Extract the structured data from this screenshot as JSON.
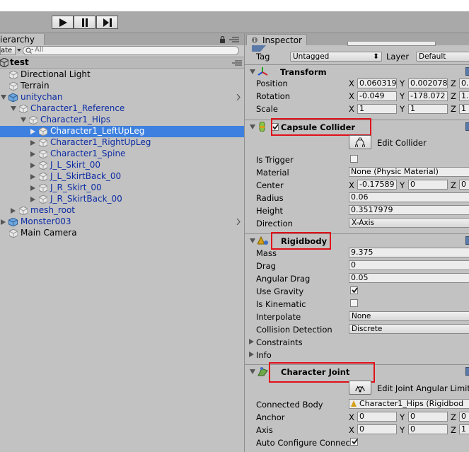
{
  "toolbar": {
    "play_icon": "play-icon",
    "pause_icon": "pause-icon",
    "step_icon": "step-icon"
  },
  "hierarchy": {
    "tab_label": "ierarchy",
    "create_label": "ate",
    "search_placeholder": "All",
    "scene_name": "test",
    "items": [
      {
        "label": "Directional Light",
        "blue": false
      },
      {
        "label": "Terrain",
        "blue": false
      },
      {
        "label": "unitychan",
        "blue": true
      },
      {
        "label": "Character1_Reference",
        "blue": true
      },
      {
        "label": "Character1_Hips",
        "blue": true
      },
      {
        "label": "Character1_LeftUpLeg",
        "blue": true,
        "selected": true
      },
      {
        "label": "Character1_RightUpLeg",
        "blue": true
      },
      {
        "label": "Character1_Spine",
        "blue": true
      },
      {
        "label": "J_L_Skirt_00",
        "blue": true
      },
      {
        "label": "J_L_SkirtBack_00",
        "blue": true
      },
      {
        "label": "J_R_Skirt_00",
        "blue": true
      },
      {
        "label": "J_R_SkirtBack_00",
        "blue": true
      },
      {
        "label": "mesh_root",
        "blue": true
      },
      {
        "label": "Monster003",
        "blue": true
      },
      {
        "label": "Main Camera",
        "blue": false
      }
    ]
  },
  "inspector": {
    "tab_label": "Inspector",
    "tag_label": "Tag",
    "tag_value": "Untagged",
    "layer_label": "Layer",
    "layer_value": "Default",
    "transform": {
      "title": "Transform",
      "position_label": "Position",
      "position": [
        "0.060319",
        "0.002078",
        "0."
      ],
      "rotation_label": "Rotation",
      "rotation": [
        "-0.049",
        "-178.072",
        "1."
      ],
      "scale_label": "Scale",
      "scale": [
        "1",
        "1",
        "1"
      ],
      "x": "X",
      "y": "Y",
      "z": "Z"
    },
    "capsule": {
      "title": "Capsule Collider",
      "edit_label": "Edit Collider",
      "is_trigger_label": "Is Trigger",
      "material_label": "Material",
      "material_value": "None (Physic Material)",
      "center_label": "Center",
      "center": [
        "-0.17589",
        "0",
        "0"
      ],
      "radius_label": "Radius",
      "radius_value": "0.06",
      "height_label": "Height",
      "height_value": "0.3517979",
      "direction_label": "Direction",
      "direction_value": "X-Axis"
    },
    "rigidbody": {
      "title": "Rigidbody",
      "mass_label": "Mass",
      "mass_value": "9.375",
      "drag_label": "Drag",
      "drag_value": "0",
      "angular_drag_label": "Angular Drag",
      "angular_drag_value": "0.05",
      "use_gravity_label": "Use Gravity",
      "is_kinematic_label": "Is Kinematic",
      "interpolate_label": "Interpolate",
      "interpolate_value": "None",
      "collision_label": "Collision Detection",
      "collision_value": "Discrete",
      "constraints_label": "Constraints",
      "info_label": "Info"
    },
    "joint": {
      "title": "Character Joint",
      "edit_label": "Edit Joint Angular Limit",
      "connected_label": "Connected Body",
      "connected_value": "Character1_Hips (Rigidbod",
      "anchor_label": "Anchor",
      "anchor": [
        "0",
        "0",
        "0"
      ],
      "axis_label": "Axis",
      "axis": [
        "0",
        "0",
        "1"
      ],
      "auto_label": "Auto Configure Connec"
    },
    "colors": {
      "highlight": "#e0101a",
      "selection": "#3d80df",
      "prefab_text": "#0d2ca3"
    }
  }
}
